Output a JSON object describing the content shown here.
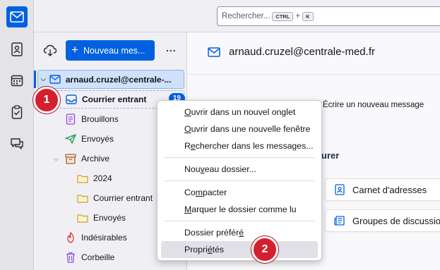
{
  "search": {
    "placeholder": "Rechercher...",
    "shortcut_mod": "CTRL",
    "shortcut_plus": "+",
    "shortcut_key": "K"
  },
  "toolbar": {
    "new_message_label": "Nouveau mes...",
    "more_label": "..."
  },
  "account": {
    "name": "arnaud.cruzel@centrale-...",
    "email": "arnaud.cruzel@centrale-med.fr"
  },
  "folders": [
    {
      "label": "Courrier entrant",
      "icon": "inbox-icon",
      "unread": "19"
    },
    {
      "label": "Brouillons",
      "icon": "drafts-icon"
    },
    {
      "label": "Envoyés",
      "icon": "sent-icon"
    },
    {
      "label": "Archive",
      "icon": "archive-icon"
    },
    {
      "label": "2024",
      "icon": "folder-icon"
    },
    {
      "label": "Courrier entrant",
      "icon": "folder-icon"
    },
    {
      "label": "Envoyés",
      "icon": "folder-icon"
    },
    {
      "label": "Indésirables",
      "icon": "junk-icon"
    },
    {
      "label": "Corbeille",
      "icon": "trash-icon"
    }
  ],
  "main": {
    "write_text": "Écrire un nouveau message",
    "setup_text": "urer",
    "card_address_book": "Carnet d'adresses",
    "card_newsgroups": "Groupes de discussion"
  },
  "context_menu": [
    {
      "pre": "",
      "acc": "O",
      "post": "uvrir dans un nouvel onglet"
    },
    {
      "pre": "",
      "acc": "O",
      "post": "uvrir dans une nouvelle fenêtre"
    },
    {
      "pre": "R",
      "acc": "e",
      "post": "chercher dans les messages..."
    },
    {
      "pre": "Nou",
      "acc": "v",
      "post": "eau dossier..."
    },
    {
      "pre": "Co",
      "acc": "m",
      "post": "pacter"
    },
    {
      "pre": "",
      "acc": "M",
      "post": "arquer le dossier comme lu"
    },
    {
      "pre": "Dossier préfér",
      "acc": "é",
      "post": ""
    },
    {
      "pre": "Propri",
      "acc": "é",
      "post": "tés"
    }
  ],
  "badges": {
    "step1": "1",
    "step2": "2"
  },
  "colors": {
    "accent": "#0061e0",
    "badge": "#d41f2e",
    "selection": "#cfe1fb"
  }
}
